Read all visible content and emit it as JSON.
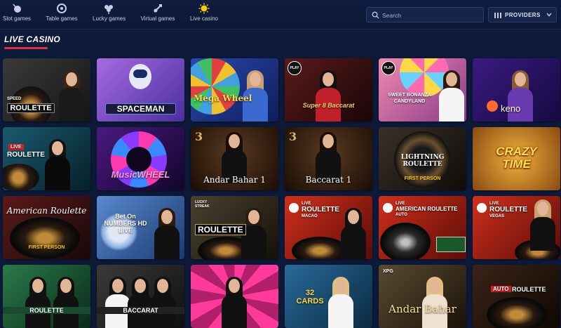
{
  "nav": {
    "categories": [
      {
        "label": "Slot games",
        "icon": "slot-games-icon"
      },
      {
        "label": "Table games",
        "icon": "table-games-icon"
      },
      {
        "label": "Lucky games",
        "icon": "lucky-games-icon"
      },
      {
        "label": "Virtual games",
        "icon": "virtual-games-icon"
      },
      {
        "label": "Live casino",
        "icon": "live-casino-icon",
        "active": true
      }
    ]
  },
  "search": {
    "placeholder": "Search"
  },
  "providers": {
    "label": "PROVIDERS"
  },
  "section": {
    "title": "LIVE CASINO",
    "accent": "#e0333f"
  },
  "tiles": [
    {
      "title": "ROULETTE",
      "small": "SPEED",
      "bg": "#2a2a2a"
    },
    {
      "title": "SPACEMAN",
      "small": "",
      "bg": "#6b3fb8"
    },
    {
      "title": "Mega Wheel",
      "small": "",
      "bg": "#1b3a8a"
    },
    {
      "title": "Super 8 Baccarat",
      "small": "PLAY",
      "bg": "#3a0d12"
    },
    {
      "title": "SWEET BONANZA CANDYLAND",
      "small": "PLAY",
      "bg": "#c4567f"
    },
    {
      "title": "keno",
      "small": "",
      "bg": "#2a1466"
    },
    {
      "title": "ROULETTE",
      "small": "LIVE",
      "bg": "#0d3b4a"
    },
    {
      "title": "MusicWHEEL",
      "small": "",
      "bg": "#2a0f4a"
    },
    {
      "title": "Andar Bahar 1",
      "small": "3",
      "bg": "#3a2514"
    },
    {
      "title": "Baccarat 1",
      "small": "3",
      "bg": "#3a2514"
    },
    {
      "title": "LIGHTNING ROULETTE",
      "small": "FIRST PERSON",
      "bg": "#26201a"
    },
    {
      "title": "CRAZY TIME",
      "small": "",
      "bg": "#b36b1a"
    },
    {
      "title": "American Roulette",
      "small": "FIRST PERSON",
      "bg": "#3a1414"
    },
    {
      "title": "Bet On NUMBERS HD LIVE",
      "small": "",
      "bg": "#2d5aa0"
    },
    {
      "title": "ROULETTE",
      "small": "LUCKY STREAK",
      "bg": "#3a3424"
    },
    {
      "title": "ROULETTE",
      "small": "LIVE",
      "sub": "MACAO",
      "bg": "#b5261c"
    },
    {
      "title": "AMERICAN ROULETTE",
      "small": "LIVE",
      "sub": "AUTO",
      "bg": "#b5261c"
    },
    {
      "title": "ROULETTE",
      "small": "LIVE",
      "sub": "VEGAS",
      "bg": "#b5261c"
    },
    {
      "title": "ROULETTE",
      "small": "",
      "bg": "#1d5a3a"
    },
    {
      "title": "BACCARAT",
      "small": "",
      "bg": "#2a2a2a"
    },
    {
      "title": "",
      "small": "",
      "bg": "#c4336a"
    },
    {
      "title": "32 CARDS",
      "small": "",
      "bg": "#1d4a6a"
    },
    {
      "title": "Andar Bahar",
      "small": "XPG",
      "bg": "#4a3a22"
    },
    {
      "title": "ROULETTE",
      "small": "AUTO",
      "bg": "#2a1810"
    }
  ]
}
